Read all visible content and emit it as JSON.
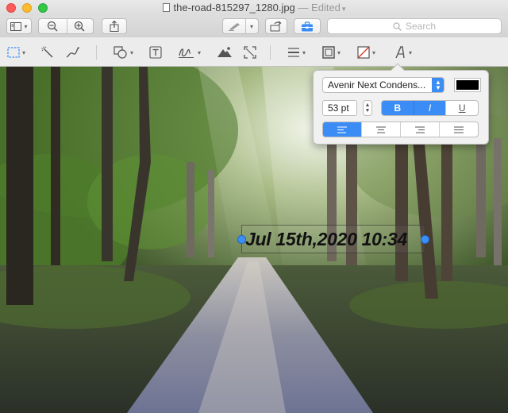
{
  "window": {
    "title": "the-road-815297_1280.jpg",
    "separator": "—",
    "edited_label": "Edited",
    "title_menu_icon": "chevron-down-icon"
  },
  "toolbar": {
    "buttons": [
      {
        "name": "sidebar-view-button",
        "icon": "sidebar-icon"
      },
      {
        "name": "zoom-out-button",
        "icon": "zoom-out-icon"
      },
      {
        "name": "zoom-in-button",
        "icon": "zoom-in-icon"
      },
      {
        "name": "share-button",
        "icon": "share-icon"
      },
      {
        "name": "pen-button",
        "icon": "pen-icon"
      },
      {
        "name": "rotate-button",
        "icon": "rotate-icon"
      },
      {
        "name": "markup-toolbox-button",
        "icon": "toolbox-icon",
        "active": true
      }
    ],
    "search_placeholder": "Search",
    "active_color": "#3b8df5"
  },
  "markup_tools": [
    {
      "name": "rectangular-selection",
      "icon": "dashed-rect-icon"
    },
    {
      "name": "instant-alpha",
      "icon": "magic-wand-icon"
    },
    {
      "name": "sketch",
      "icon": "sketch-icon"
    },
    {
      "name": "shapes",
      "icon": "shapes-icon"
    },
    {
      "name": "text",
      "icon": "text-box-icon"
    },
    {
      "name": "sign",
      "icon": "signature-icon"
    },
    {
      "name": "adjust-color",
      "icon": "adjust-color-icon"
    },
    {
      "name": "adjust-size",
      "icon": "resize-icon"
    },
    {
      "name": "shape-style",
      "icon": "lines-icon"
    },
    {
      "name": "border-color",
      "icon": "border-color-icon"
    },
    {
      "name": "fill-color",
      "icon": "fill-color-icon"
    },
    {
      "name": "text-style",
      "icon": "text-style-icon"
    }
  ],
  "annotation": {
    "text": "Jul 15th,2020 10:34"
  },
  "text_style_popover": {
    "font": "Avenir Next Condens...",
    "color": "#000000",
    "size": "53 pt",
    "bold_label": "B",
    "italic_label": "I",
    "underline_label": "U",
    "bold_on": true,
    "italic_on": true,
    "underline_on": false,
    "alignments": [
      "left",
      "center",
      "right",
      "justify"
    ],
    "selected_alignment": "left"
  }
}
